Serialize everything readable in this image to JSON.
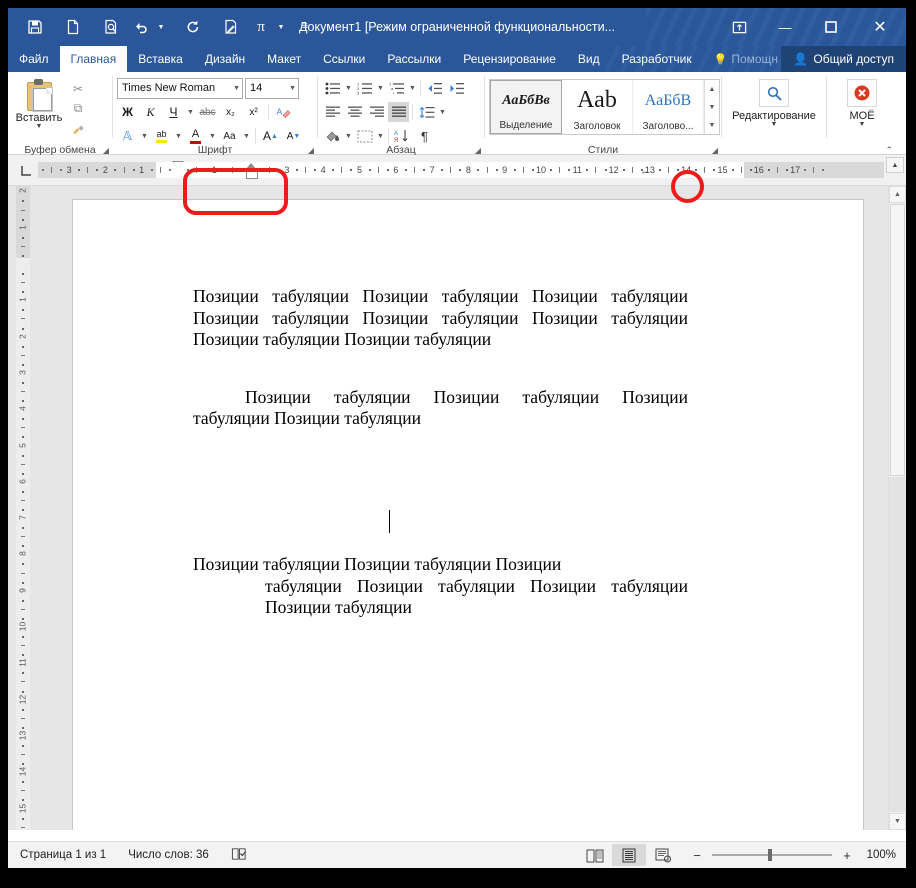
{
  "window": {
    "title": "Документ1 [Режим ограниченной функциональности...",
    "restore_label": "↥",
    "minimize_label": "—",
    "maximize_label": "▢",
    "close_label": "✕"
  },
  "quick_access": [
    {
      "name": "save-icon",
      "glyph": "save"
    },
    {
      "name": "new-document-icon",
      "glyph": "newdoc"
    },
    {
      "name": "print-preview-icon",
      "glyph": "preview"
    },
    {
      "name": "undo-icon",
      "glyph": "undo"
    },
    {
      "name": "redo-icon",
      "glyph": "redo"
    },
    {
      "name": "edit-document-icon",
      "glyph": "editdoc"
    },
    {
      "name": "equation-icon",
      "glyph": "pi"
    },
    {
      "name": "customize-qat-icon",
      "glyph": "more"
    }
  ],
  "tabs": [
    {
      "label": "Файл",
      "active": false,
      "dim": false
    },
    {
      "label": "Главная",
      "active": true,
      "dim": false
    },
    {
      "label": "Вставка",
      "active": false,
      "dim": false
    },
    {
      "label": "Дизайн",
      "active": false,
      "dim": false
    },
    {
      "label": "Макет",
      "active": false,
      "dim": false
    },
    {
      "label": "Ссылки",
      "active": false,
      "dim": false
    },
    {
      "label": "Рассылки",
      "active": false,
      "dim": false
    },
    {
      "label": "Рецензирование",
      "active": false,
      "dim": false
    },
    {
      "label": "Вид",
      "active": false,
      "dim": false
    },
    {
      "label": "Разработчик",
      "active": false,
      "dim": false
    },
    {
      "label": "Помощн",
      "active": false,
      "dim": true
    }
  ],
  "share": {
    "label": "Общий доступ",
    "icon": "person-share-icon"
  },
  "ribbon": {
    "clipboard": {
      "group_label": "Буфер обмена",
      "paste_label": "Вставить",
      "cut_label": "✂",
      "copy_label": "⧉",
      "format_painter_label": "🖌"
    },
    "font": {
      "group_label": "Шрифт",
      "font_name": "Times New Roman",
      "font_size": "14",
      "bold": "Ж",
      "italic": "К",
      "underline": "Ч",
      "strikethrough": "abc",
      "subscript": "x₂",
      "superscript": "x²",
      "clear_format": "A",
      "text_effects": "A",
      "highlight": "ab",
      "font_color": "A",
      "change_case": "Aa",
      "grow_font": "A",
      "shrink_font": "A"
    },
    "paragraph": {
      "group_label": "Абзац",
      "bullets": "≔",
      "numbering": "≔",
      "multilevel": "≔",
      "decrease_indent": "⇤",
      "increase_indent": "⇥",
      "align_left": "≡",
      "align_center": "≡",
      "align_right": "≡",
      "justify": "≡",
      "line_spacing": "↕",
      "shading": "▨",
      "borders": "⊞",
      "sort": "AЯ↓",
      "show_marks": "¶"
    },
    "styles": {
      "group_label": "Стили",
      "items": [
        {
          "preview": "АаБбВв",
          "label": "Выделение",
          "selected": true
        },
        {
          "preview": "Ааb",
          "label": "Заголовок",
          "selected": false
        },
        {
          "preview": "АаБбВ",
          "label": "Заголово...",
          "selected": false
        }
      ]
    },
    "editing": {
      "label": "Редактирование",
      "icon": "magnifier-icon"
    },
    "moyo": {
      "label": "МОЁ",
      "icon": "red-x-circle-icon"
    },
    "collapse_ribbon": "⌃"
  },
  "ruler": {
    "tab_stop_selector": "⌐",
    "horizontal_ticks": [
      "3",
      "2",
      "1",
      "1",
      "2",
      "3",
      "4",
      "5",
      "6",
      "7",
      "8",
      "9",
      "10",
      "11",
      "12",
      "13",
      "14",
      "15",
      "16",
      "17"
    ],
    "vertical_ticks": [
      "2",
      "1",
      "1",
      "2",
      "3",
      "4",
      "5",
      "6",
      "7",
      "8",
      "9",
      "10",
      "11",
      "12",
      "13",
      "14",
      "15"
    ]
  },
  "document": {
    "paragraph_1": "Позиции табуляции Позиции табуляции Позиции табуляции Позиции табуляции Позиции табуляции Позиции табуляции Позиции табуляции Позиции табуляции",
    "paragraph_2": "Позиции табуляции Позиции табуляции Позиции табуляции Позиции табуляции",
    "paragraph_3_line1": "Позиции     табуляции     Позиции     табуляции     Позиции",
    "paragraph_3_rest": "табуляции Позиции табуляции Позиции табуляции Позиции табуляции"
  },
  "status_bar": {
    "page_info": "Страница 1 из 1",
    "word_count": "Число слов: 36",
    "proofing_icon": "spellcheck-icon",
    "views": [
      {
        "name": "read-mode-icon",
        "glyph": "📖",
        "selected": false
      },
      {
        "name": "print-layout-icon",
        "glyph": "▤",
        "selected": true
      },
      {
        "name": "web-layout-icon",
        "glyph": "▥",
        "selected": false
      }
    ],
    "zoom_out": "−",
    "zoom_in": "+",
    "zoom_level": "100%"
  },
  "annotations": [
    {
      "name": "indent-markers-highlight",
      "shape": "rounded-rect"
    },
    {
      "name": "tab-stop-marker-highlight",
      "shape": "circle"
    }
  ]
}
